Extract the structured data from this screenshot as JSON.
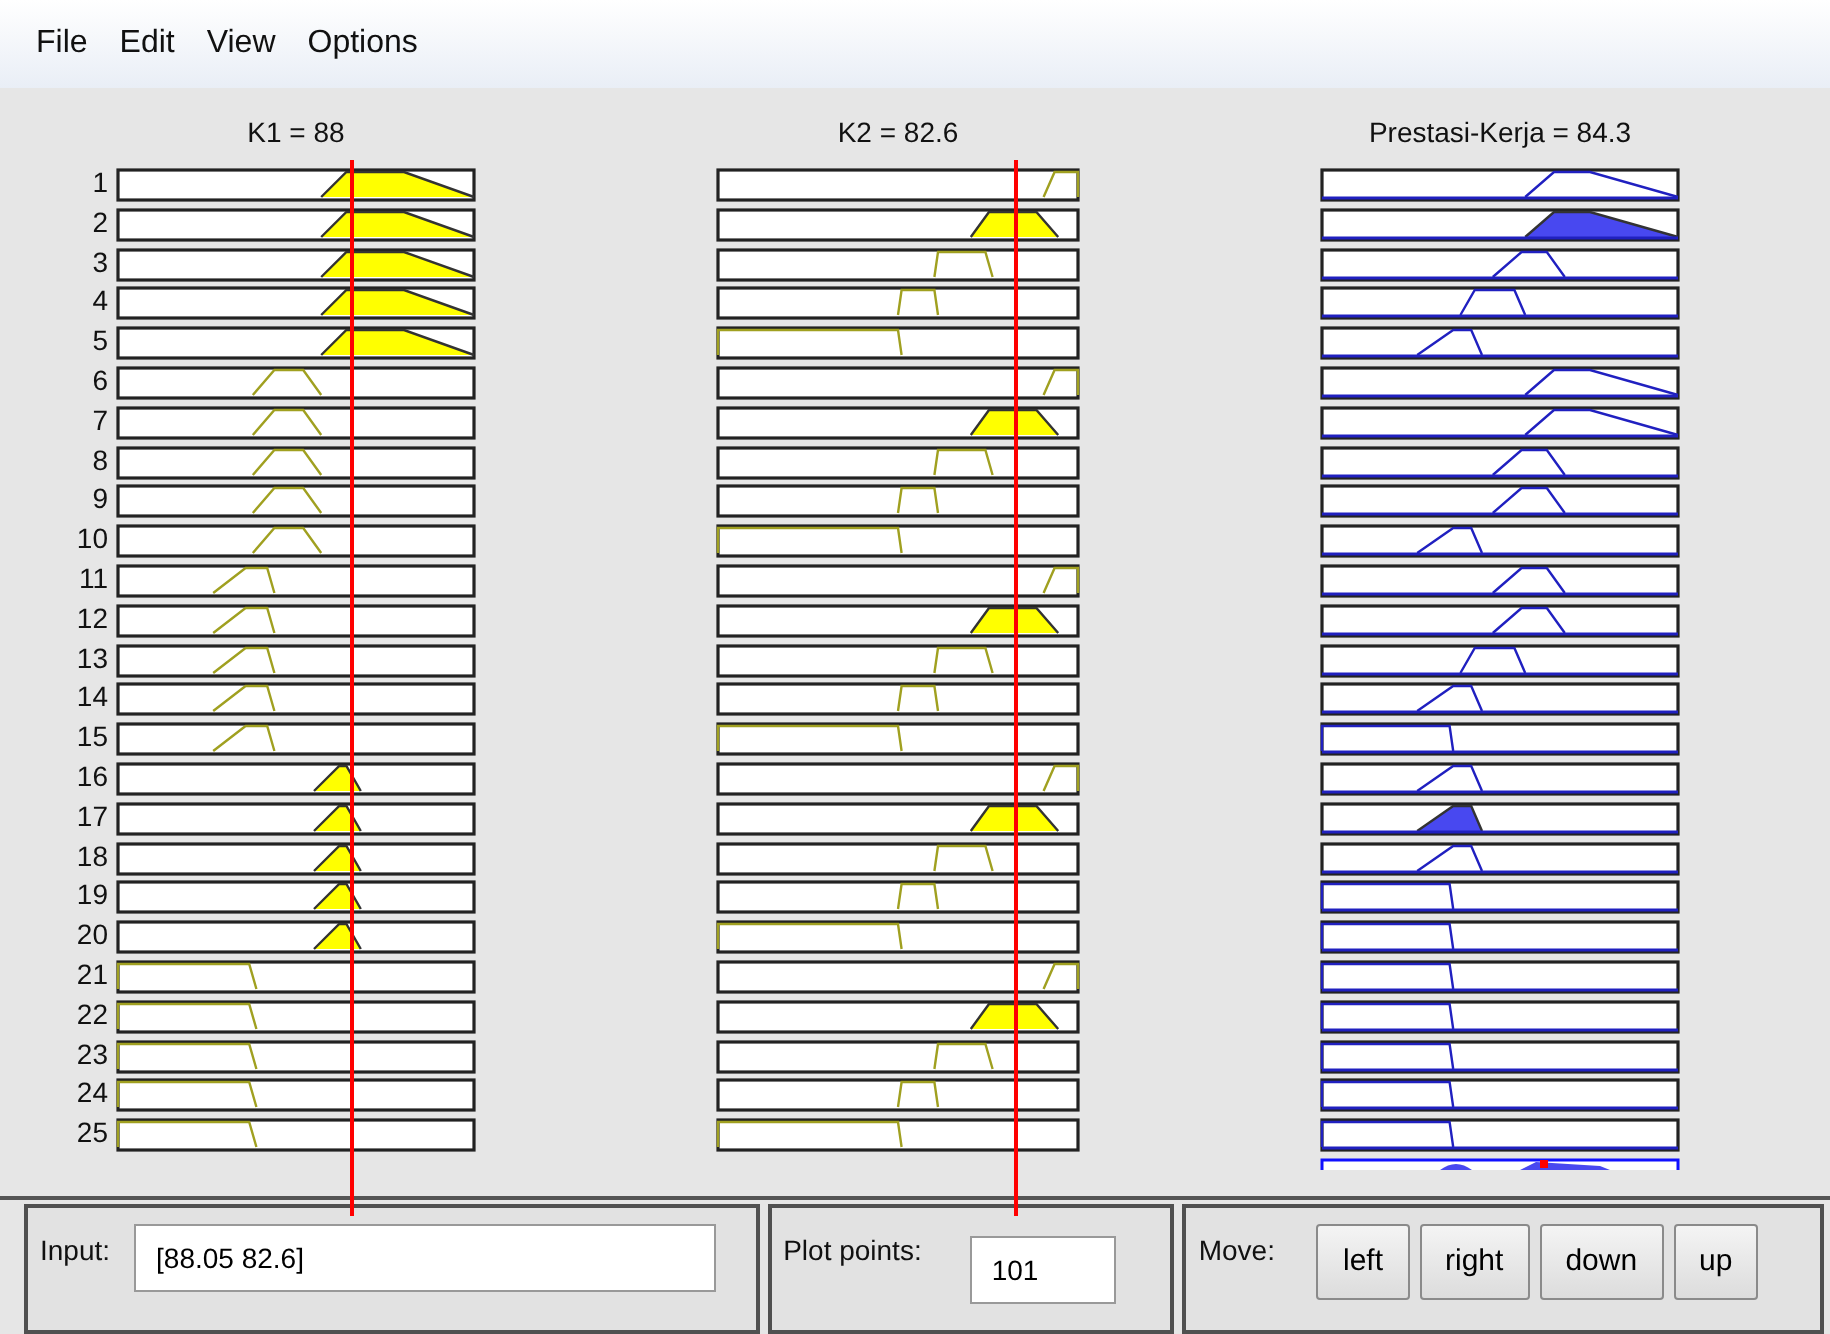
{
  "menu": [
    "File",
    "Edit",
    "View",
    "Options"
  ],
  "columns": [
    {
      "title": "K1 = 88",
      "kind": "input"
    },
    {
      "title": "K2 = 82.6",
      "kind": "input"
    },
    {
      "title": "Prestasi-Kerja = 84.3",
      "kind": "output"
    }
  ],
  "rules": [
    {
      "number": "1",
      "cells": [
        {
          "kind": "high",
          "fired": true
        },
        {
          "kind": "vhigh",
          "fired": false
        },
        {
          "kind": "o-top",
          "fired": false
        }
      ]
    },
    {
      "number": "2",
      "cells": [
        {
          "kind": "high",
          "fired": true
        },
        {
          "kind": "high",
          "fired": true
        },
        {
          "kind": "o-top",
          "fired": true
        }
      ]
    },
    {
      "number": "3",
      "cells": [
        {
          "kind": "high",
          "fired": true
        },
        {
          "kind": "mid",
          "fired": false
        },
        {
          "kind": "o-a",
          "fired": false
        }
      ]
    },
    {
      "number": "4",
      "cells": [
        {
          "kind": "high",
          "fired": true
        },
        {
          "kind": "lowmid",
          "fired": false
        },
        {
          "kind": "o-b",
          "fired": false
        }
      ]
    },
    {
      "number": "5",
      "cells": [
        {
          "kind": "high",
          "fired": true
        },
        {
          "kind": "low",
          "fired": false
        },
        {
          "kind": "o-c",
          "fired": false
        }
      ]
    },
    {
      "number": "6",
      "cells": [
        {
          "kind": "mid",
          "fired": false
        },
        {
          "kind": "vhigh",
          "fired": false
        },
        {
          "kind": "o-top",
          "fired": false
        }
      ]
    },
    {
      "number": "7",
      "cells": [
        {
          "kind": "mid",
          "fired": false
        },
        {
          "kind": "high",
          "fired": true
        },
        {
          "kind": "o-top",
          "fired": false
        }
      ]
    },
    {
      "number": "8",
      "cells": [
        {
          "kind": "mid",
          "fired": false
        },
        {
          "kind": "mid",
          "fired": false
        },
        {
          "kind": "o-a",
          "fired": false
        }
      ]
    },
    {
      "number": "9",
      "cells": [
        {
          "kind": "mid",
          "fired": false
        },
        {
          "kind": "lowmid",
          "fired": false
        },
        {
          "kind": "o-a",
          "fired": false
        }
      ]
    },
    {
      "number": "10",
      "cells": [
        {
          "kind": "mid",
          "fired": false
        },
        {
          "kind": "low",
          "fired": false
        },
        {
          "kind": "o-c",
          "fired": false
        }
      ]
    },
    {
      "number": "11",
      "cells": [
        {
          "kind": "lowmid",
          "fired": false
        },
        {
          "kind": "vhigh",
          "fired": false
        },
        {
          "kind": "o-a",
          "fired": false
        }
      ]
    },
    {
      "number": "12",
      "cells": [
        {
          "kind": "lowmid",
          "fired": false
        },
        {
          "kind": "high",
          "fired": true
        },
        {
          "kind": "o-a",
          "fired": false
        }
      ]
    },
    {
      "number": "13",
      "cells": [
        {
          "kind": "lowmid",
          "fired": false
        },
        {
          "kind": "mid",
          "fired": false
        },
        {
          "kind": "o-b",
          "fired": false
        }
      ]
    },
    {
      "number": "14",
      "cells": [
        {
          "kind": "lowmid",
          "fired": false
        },
        {
          "kind": "lowmid",
          "fired": false
        },
        {
          "kind": "o-c",
          "fired": false
        }
      ]
    },
    {
      "number": "15",
      "cells": [
        {
          "kind": "lowmid",
          "fired": false
        },
        {
          "kind": "low",
          "fired": false
        },
        {
          "kind": "o-low",
          "fired": false
        }
      ]
    },
    {
      "number": "16",
      "cells": [
        {
          "kind": "upmid",
          "fired": true
        },
        {
          "kind": "vhigh",
          "fired": false
        },
        {
          "kind": "o-c",
          "fired": false
        }
      ]
    },
    {
      "number": "17",
      "cells": [
        {
          "kind": "upmid",
          "fired": true
        },
        {
          "kind": "high",
          "fired": true
        },
        {
          "kind": "o-c",
          "fired": true
        }
      ]
    },
    {
      "number": "18",
      "cells": [
        {
          "kind": "upmid",
          "fired": true
        },
        {
          "kind": "mid",
          "fired": false
        },
        {
          "kind": "o-c",
          "fired": false
        }
      ]
    },
    {
      "number": "19",
      "cells": [
        {
          "kind": "upmid",
          "fired": true
        },
        {
          "kind": "lowmid",
          "fired": false
        },
        {
          "kind": "o-low",
          "fired": false
        }
      ]
    },
    {
      "number": "20",
      "cells": [
        {
          "kind": "upmid",
          "fired": true
        },
        {
          "kind": "low",
          "fired": false
        },
        {
          "kind": "o-low",
          "fired": false
        }
      ]
    },
    {
      "number": "21",
      "cells": [
        {
          "kind": "low",
          "fired": false
        },
        {
          "kind": "vhigh",
          "fired": false
        },
        {
          "kind": "o-low",
          "fired": false
        }
      ]
    },
    {
      "number": "22",
      "cells": [
        {
          "kind": "low",
          "fired": false
        },
        {
          "kind": "high",
          "fired": true
        },
        {
          "kind": "o-low",
          "fired": false
        }
      ]
    },
    {
      "number": "23",
      "cells": [
        {
          "kind": "low",
          "fired": false
        },
        {
          "kind": "mid",
          "fired": false
        },
        {
          "kind": "o-low",
          "fired": false
        }
      ]
    },
    {
      "number": "24",
      "cells": [
        {
          "kind": "low",
          "fired": false
        },
        {
          "kind": "lowmid",
          "fired": false
        },
        {
          "kind": "o-low",
          "fired": false
        }
      ]
    },
    {
      "number": "25",
      "cells": [
        {
          "kind": "low",
          "fired": false
        },
        {
          "kind": "low",
          "fired": false
        },
        {
          "kind": "o-low",
          "fired": false
        }
      ]
    }
  ],
  "input": {
    "label": "Input:",
    "value": "[88.05 82.6]"
  },
  "plot_points": {
    "label": "Plot points:",
    "value": "101"
  },
  "move": {
    "label": "Move:",
    "buttons": [
      "left",
      "right",
      "down",
      "up"
    ]
  }
}
